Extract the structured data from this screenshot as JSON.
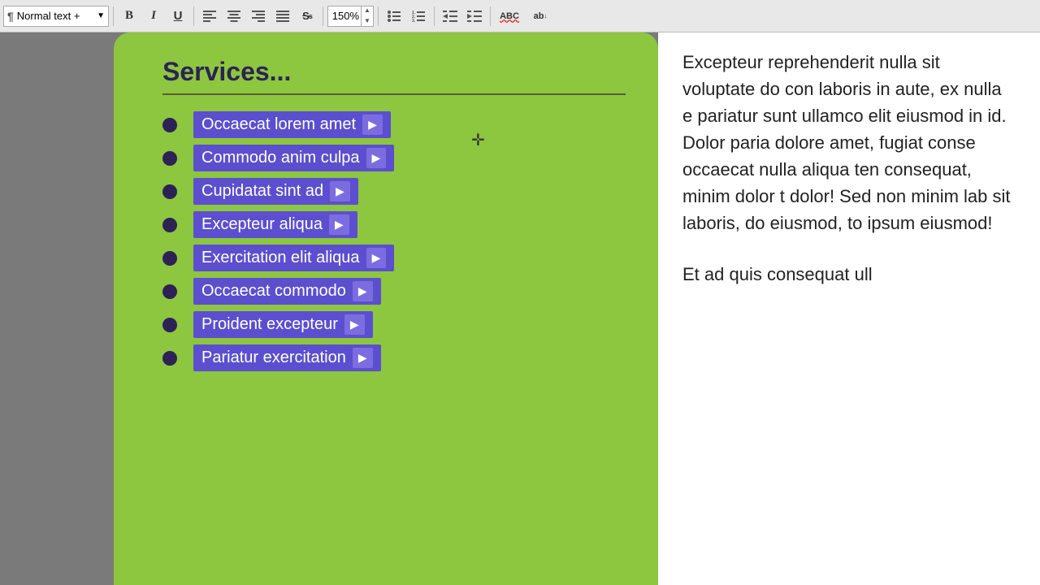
{
  "toolbar": {
    "style_label": "Normal text +",
    "bold": "B",
    "italic": "I",
    "underline": "U",
    "strikethrough": "S",
    "zoom_value": "150%",
    "align_left": "≡",
    "align_center": "≡",
    "align_right": "≡",
    "align_justify": "≡",
    "list_unordered": "☰",
    "list_ordered": "☰",
    "indent_decrease": "⇤",
    "indent_increase": "⇥",
    "spell_check": "ABC",
    "autocorrect": "ab"
  },
  "green_panel": {
    "title": "Services...",
    "items": [
      {
        "text": "Occaecat lorem amet",
        "has_arrow": true
      },
      {
        "text": "Commodo anim culpa",
        "has_arrow": true
      },
      {
        "text": "Cupidatat sint ad",
        "has_arrow": true
      },
      {
        "text": "Excepteur aliqua",
        "has_arrow": true
      },
      {
        "text": "Exercitation elit aliqua",
        "has_arrow": true
      },
      {
        "text": "Occaecat commodo",
        "has_arrow": true
      },
      {
        "text": "Proident excepteur",
        "has_arrow": true
      },
      {
        "text": "Pariatur exercitation",
        "has_arrow": true
      }
    ]
  },
  "right_panel": {
    "paragraphs": [
      "Excepteur reprehenderit nulla sit voluptate do con laboris in aute, ex nulla e pariatur sunt ullamco elit eiusmod in id. Dolor paria dolore amet, fugiat conse occaecat nulla aliqua ten consequat, minim dolor t dolor! Sed non minim lab sit laboris, do eiusmod, to ipsum eiusmod!",
      "Et ad quis consequat ull"
    ]
  }
}
